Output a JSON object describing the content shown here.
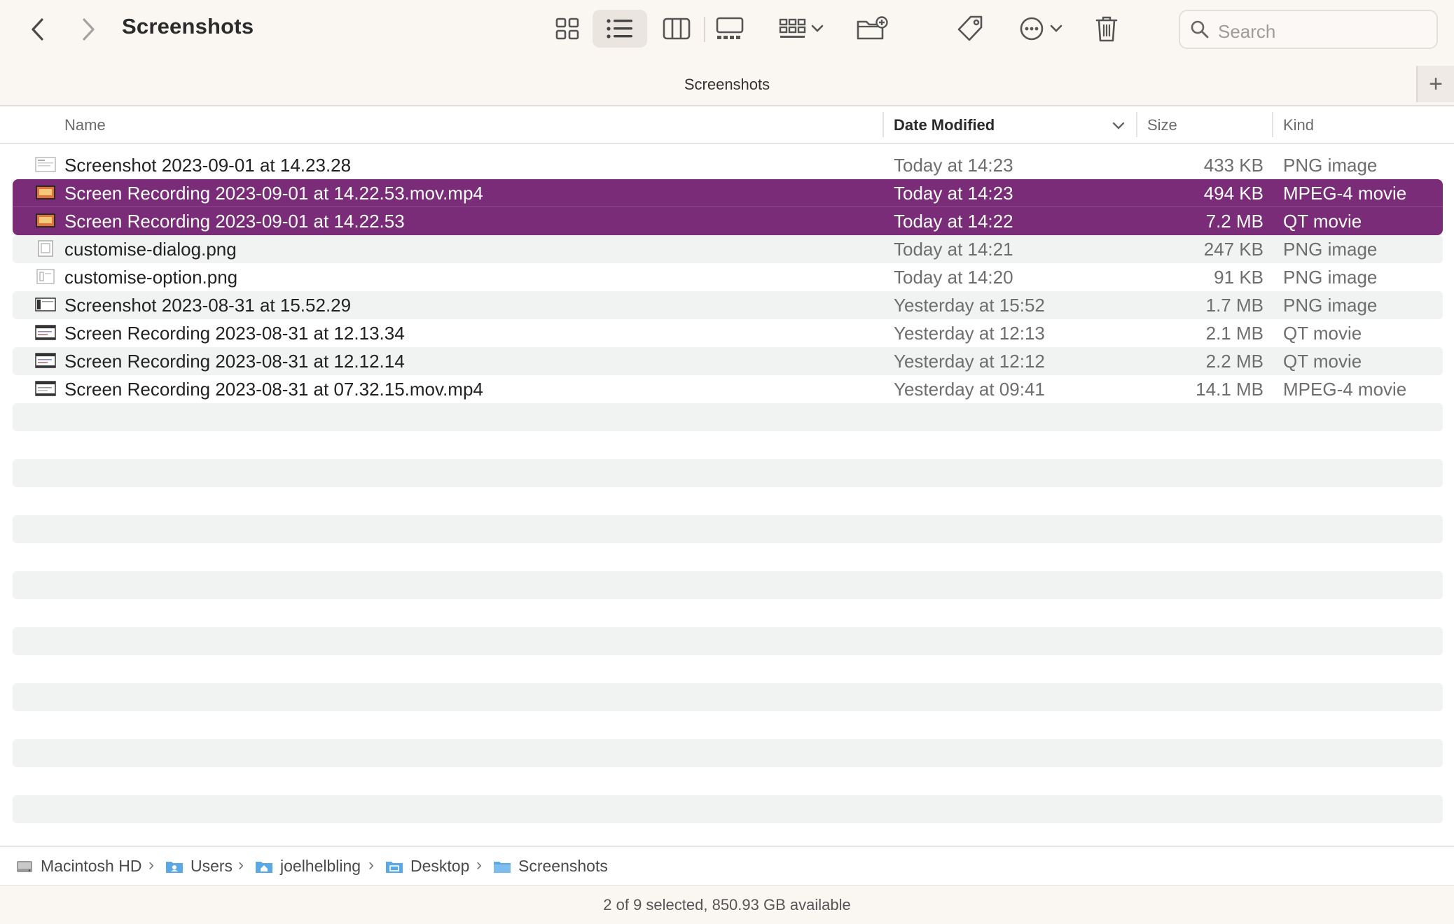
{
  "window": {
    "title": "Screenshots",
    "tab_title": "Screenshots",
    "tab_add_label": "+"
  },
  "toolbar": {
    "back_icon": "chevron-left-icon",
    "forward_icon": "chevron-right-icon",
    "view_modes": [
      "icon-view-icon",
      "list-view-icon",
      "column-view-icon",
      "gallery-view-icon"
    ],
    "active_view": "list-view-icon",
    "group_icon": "group-icon",
    "new_folder_icon": "new-folder-icon",
    "tag_icon": "tag-icon",
    "more_icon": "ellipsis-circle-icon",
    "trash_icon": "trash-icon"
  },
  "search": {
    "placeholder": "Search"
  },
  "columns": {
    "name": "Name",
    "date": "Date Modified",
    "size": "Size",
    "kind": "Kind",
    "sort_column": "Date Modified"
  },
  "files": [
    {
      "name": "Screenshot 2023-09-01 at 14.23.28",
      "date": "Today at 14:23",
      "size": "433 KB",
      "kind": "PNG image",
      "icon": "image-file-icon",
      "selected": false
    },
    {
      "name": "Screen Recording 2023-09-01 at 14.22.53.mov.mp4",
      "date": "Today at 14:23",
      "size": "494 KB",
      "kind": "MPEG-4 movie",
      "icon": "movie-file-icon",
      "selected": true
    },
    {
      "name": "Screen Recording 2023-09-01 at 14.22.53",
      "date": "Today at 14:22",
      "size": "7.2 MB",
      "kind": "QT movie",
      "icon": "movie-file-icon",
      "selected": true
    },
    {
      "name": "customise-dialog.png",
      "date": "Today at 14:21",
      "size": "247 KB",
      "kind": "PNG image",
      "icon": "image-file-icon",
      "selected": false
    },
    {
      "name": "customise-option.png",
      "date": "Today at 14:20",
      "size": "91 KB",
      "kind": "PNG image",
      "icon": "image-file-icon",
      "selected": false
    },
    {
      "name": "Screenshot 2023-08-31 at 15.52.29",
      "date": "Yesterday at 15:52",
      "size": "1.7 MB",
      "kind": "PNG image",
      "icon": "image-file-icon",
      "selected": false
    },
    {
      "name": "Screen Recording 2023-08-31 at 12.13.34",
      "date": "Yesterday at 12:13",
      "size": "2.1 MB",
      "kind": "QT movie",
      "icon": "movie-file-icon",
      "selected": false
    },
    {
      "name": "Screen Recording 2023-08-31 at 12.12.14",
      "date": "Yesterday at 12:12",
      "size": "2.2 MB",
      "kind": "QT movie",
      "icon": "movie-file-icon",
      "selected": false
    },
    {
      "name": "Screen Recording 2023-08-31 at 07.32.15.mov.mp4",
      "date": "Yesterday at 09:41",
      "size": "14.1 MB",
      "kind": "MPEG-4 movie",
      "icon": "movie-file-icon",
      "selected": false
    }
  ],
  "path": [
    {
      "label": "Macintosh HD",
      "icon": "hard-drive-icon"
    },
    {
      "label": "Users",
      "icon": "users-folder-icon"
    },
    {
      "label": "joelhelbling",
      "icon": "home-folder-icon"
    },
    {
      "label": "Desktop",
      "icon": "desktop-folder-icon"
    },
    {
      "label": "Screenshots",
      "icon": "folder-icon"
    }
  ],
  "status": {
    "text": "2 of 9 selected, 850.93 GB available"
  },
  "colors": {
    "selection": "#7a2c79",
    "toolbar_bg": "#faf6f2",
    "stripe": "#f1f2f2",
    "folder_blue": "#5aa9e6"
  }
}
